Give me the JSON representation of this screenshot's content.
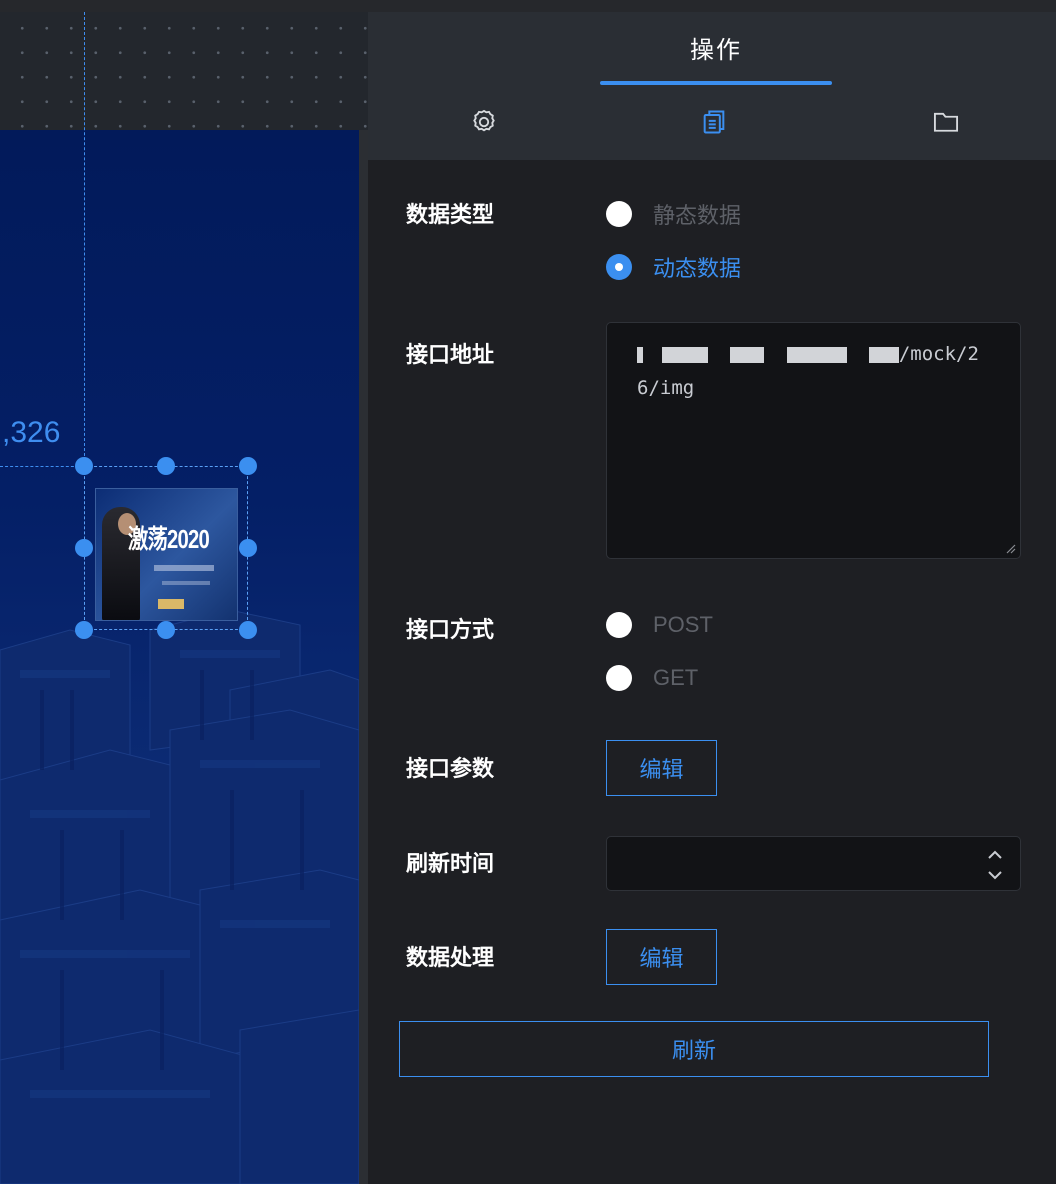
{
  "canvas": {
    "coord_text": ",326",
    "selected_image": {
      "title": "激荡2020"
    }
  },
  "panel": {
    "title": "操作",
    "tabs": [
      {
        "icon": "gear-icon"
      },
      {
        "icon": "copy-icon",
        "active": true
      },
      {
        "icon": "folder-icon"
      }
    ],
    "data_type": {
      "label": "数据类型",
      "options": [
        "静态数据",
        "动态数据"
      ],
      "selected": "动态数据"
    },
    "api_url": {
      "label": "接口地址",
      "value_suffix": "/mock/2",
      "value_line2": "6/img"
    },
    "api_method": {
      "label": "接口方式",
      "options": [
        "POST",
        "GET"
      ]
    },
    "api_params": {
      "label": "接口参数",
      "button": "编辑"
    },
    "refresh_time": {
      "label": "刷新时间",
      "value": ""
    },
    "data_processing": {
      "label": "数据处理",
      "button": "编辑"
    },
    "refresh_button": "刷新"
  },
  "colors": {
    "accent": "#3b8ff0",
    "panel_bg": "#1e1f23",
    "header_bg": "#2a2e34",
    "canvas_bg": "#041f66"
  }
}
